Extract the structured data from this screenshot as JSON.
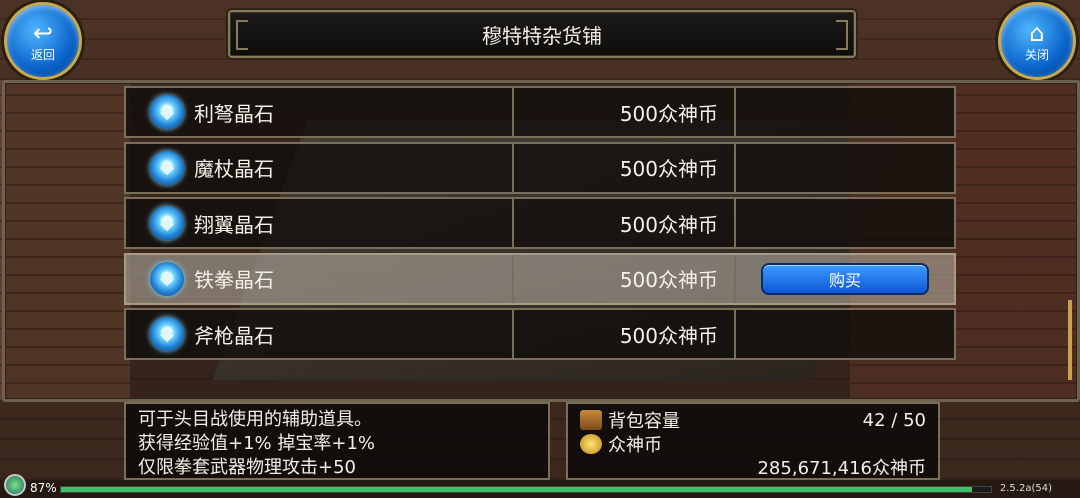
{
  "header": {
    "title": "穆特特杂货铺",
    "back_label": "返回",
    "close_label": "关闭"
  },
  "shop": {
    "items": [
      {
        "name": "利弩晶石",
        "price": "500众神币",
        "icon": "crystal-gem-icon"
      },
      {
        "name": "魔杖晶石",
        "price": "500众神币",
        "icon": "crystal-gem-icon"
      },
      {
        "name": "翔翼晶石",
        "price": "500众神币",
        "icon": "crystal-gem-icon"
      },
      {
        "name": "铁拳晶石",
        "price": "500众神币",
        "icon": "crystal-gem-icon"
      },
      {
        "name": "斧枪晶石",
        "price": "500众神币",
        "icon": "crystal-gem-icon"
      }
    ],
    "selected_index": 3,
    "buy_label": "购买"
  },
  "description": {
    "lines": [
      "可于头目战使用的辅助道具。",
      "获得经验值+1% 掉宝率+1%",
      "仅限拳套武器物理攻击+50"
    ]
  },
  "inventory": {
    "bag_label": "背包容量",
    "bag_value": "42 / 50",
    "currency_label": "众神币",
    "currency_value": "285,671,416众神币"
  },
  "status": {
    "percent": "87%",
    "exp_fraction": 0.98,
    "version": "2.5.2a(54)"
  },
  "colors": {
    "buy_button": "#1f6fe6",
    "selected_row": "#bdb6aa",
    "frame": "#7a6d5a",
    "exp_bar": "#41c06a"
  }
}
